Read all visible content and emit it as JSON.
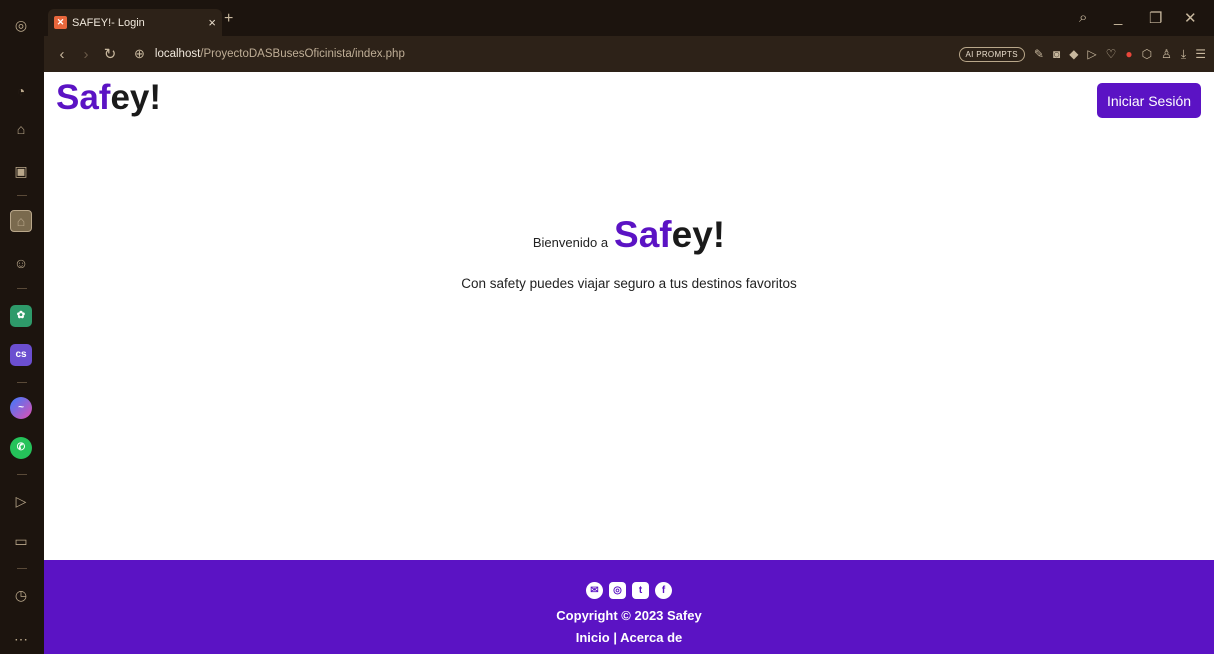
{
  "browser": {
    "tab_title": "SAFEY!- Login",
    "tab_close": "×",
    "new_tab": "+",
    "url_host": "localhost",
    "url_path": "/ProyectoDASBusesOficinista/index.php",
    "ai_prompts_label": "AI PROMPTS"
  },
  "header": {
    "logo_accent": "Saf",
    "logo_rest": "ey!",
    "login_button": "Iniciar Sesión"
  },
  "hero": {
    "welcome_prefix": "Bienvenido a",
    "brand_accent": "Saf",
    "brand_rest": "ey!",
    "tagline": "Con safety puedes viajar seguro a tus destinos favoritos"
  },
  "footer": {
    "copyright": "Copyright © 2023 Safey",
    "link_home": "Inicio",
    "separator": " | ",
    "link_about": "Acerca de",
    "social_icons": [
      "email-icon",
      "instagram-icon",
      "twitter-icon",
      "facebook-icon"
    ]
  },
  "colors": {
    "brand": "#5b13c4",
    "browser_bg": "#1c140e"
  }
}
